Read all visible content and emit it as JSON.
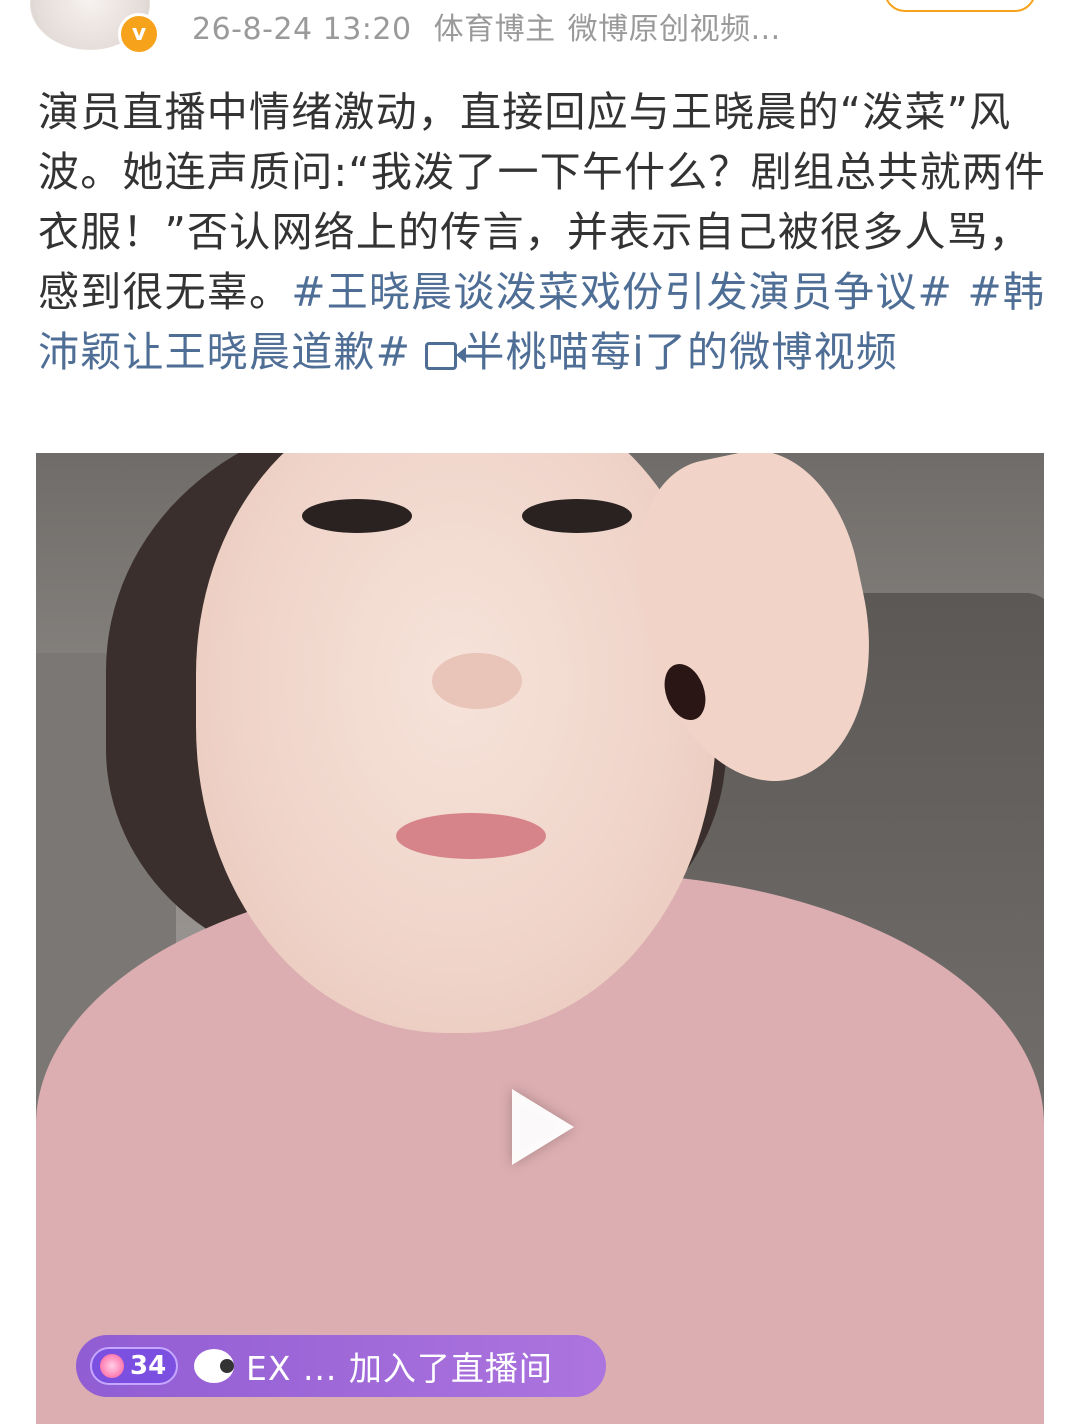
{
  "header": {
    "timestamp": "26-8-24 13:20",
    "author_tag": "体育博主",
    "source": "微博原创视频..."
  },
  "post": {
    "text": "演员直播中情绪激动，直接回应与王晓晨的“泼菜”风波。她连声质问:“我泼了一下午什么？剧组总共就两件衣服！”否认网络上的传言，并表示自己被很多人骂，感到很无辜。",
    "hashtag_1": "#王晓晨谈泼菜戏份引发演员争议#",
    "hashtag_2": "#韩沛颖让王晓晨道歉#",
    "video_link": "半桃喵莓i了的微博视频"
  },
  "video": {
    "live_level": "34",
    "live_message": "EX ... 加入了直播间"
  },
  "icons": {
    "verified": "verified-v-icon",
    "video": "video-camera-icon",
    "play": "play-icon"
  },
  "colors": {
    "link": "#4f6e96",
    "badge": "#f7a21b",
    "text": "#333333",
    "meta": "#9a9a9a"
  }
}
